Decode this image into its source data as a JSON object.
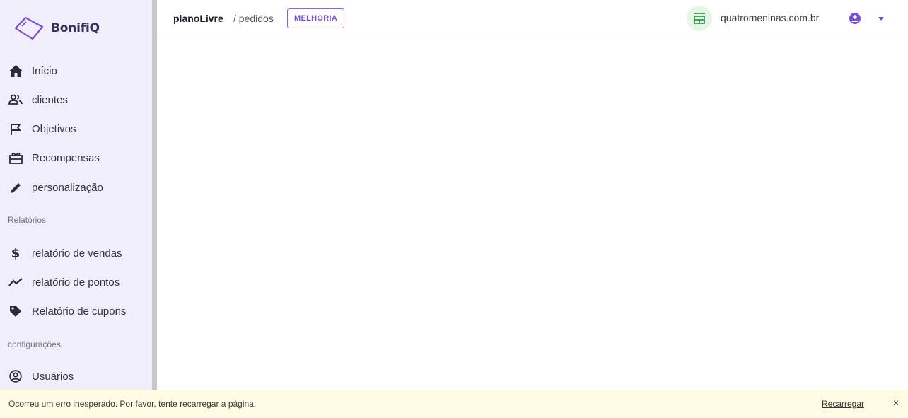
{
  "brand": {
    "name": "BonifiQ"
  },
  "sidebar": {
    "items": [
      {
        "label": "Início",
        "icon": "home-icon"
      },
      {
        "label": "clientes",
        "icon": "users-icon"
      },
      {
        "label": "Objetivos",
        "icon": "flag-icon"
      },
      {
        "label": "Recompensas",
        "icon": "gift-icon"
      },
      {
        "label": "personalização",
        "icon": "pencil-icon"
      }
    ],
    "section_reports": "Relatórios",
    "report_items": [
      {
        "label": "relatório de vendas",
        "icon": "dollar-icon"
      },
      {
        "label": "relatório de pontos",
        "icon": "trend-icon"
      },
      {
        "label": "Relatório de cupons",
        "icon": "tag-icon"
      }
    ],
    "section_config": "configurações",
    "config_items": [
      {
        "label": "Usuários",
        "icon": "user-circle-icon"
      }
    ]
  },
  "header": {
    "plan": "planoLivre",
    "page": "/ pedidos",
    "badge": "MELHORIA",
    "store": "quatromeninas.com.br",
    "colors": {
      "accent": "#7c4ddb",
      "store_bg": "#e6f5e8",
      "store_icon": "#2e9e4a"
    }
  },
  "banner": {
    "message": "Ocorreu um erro inesperado. Por favor, tente recarregar a página.",
    "action": "Recarregar",
    "close": "×"
  }
}
